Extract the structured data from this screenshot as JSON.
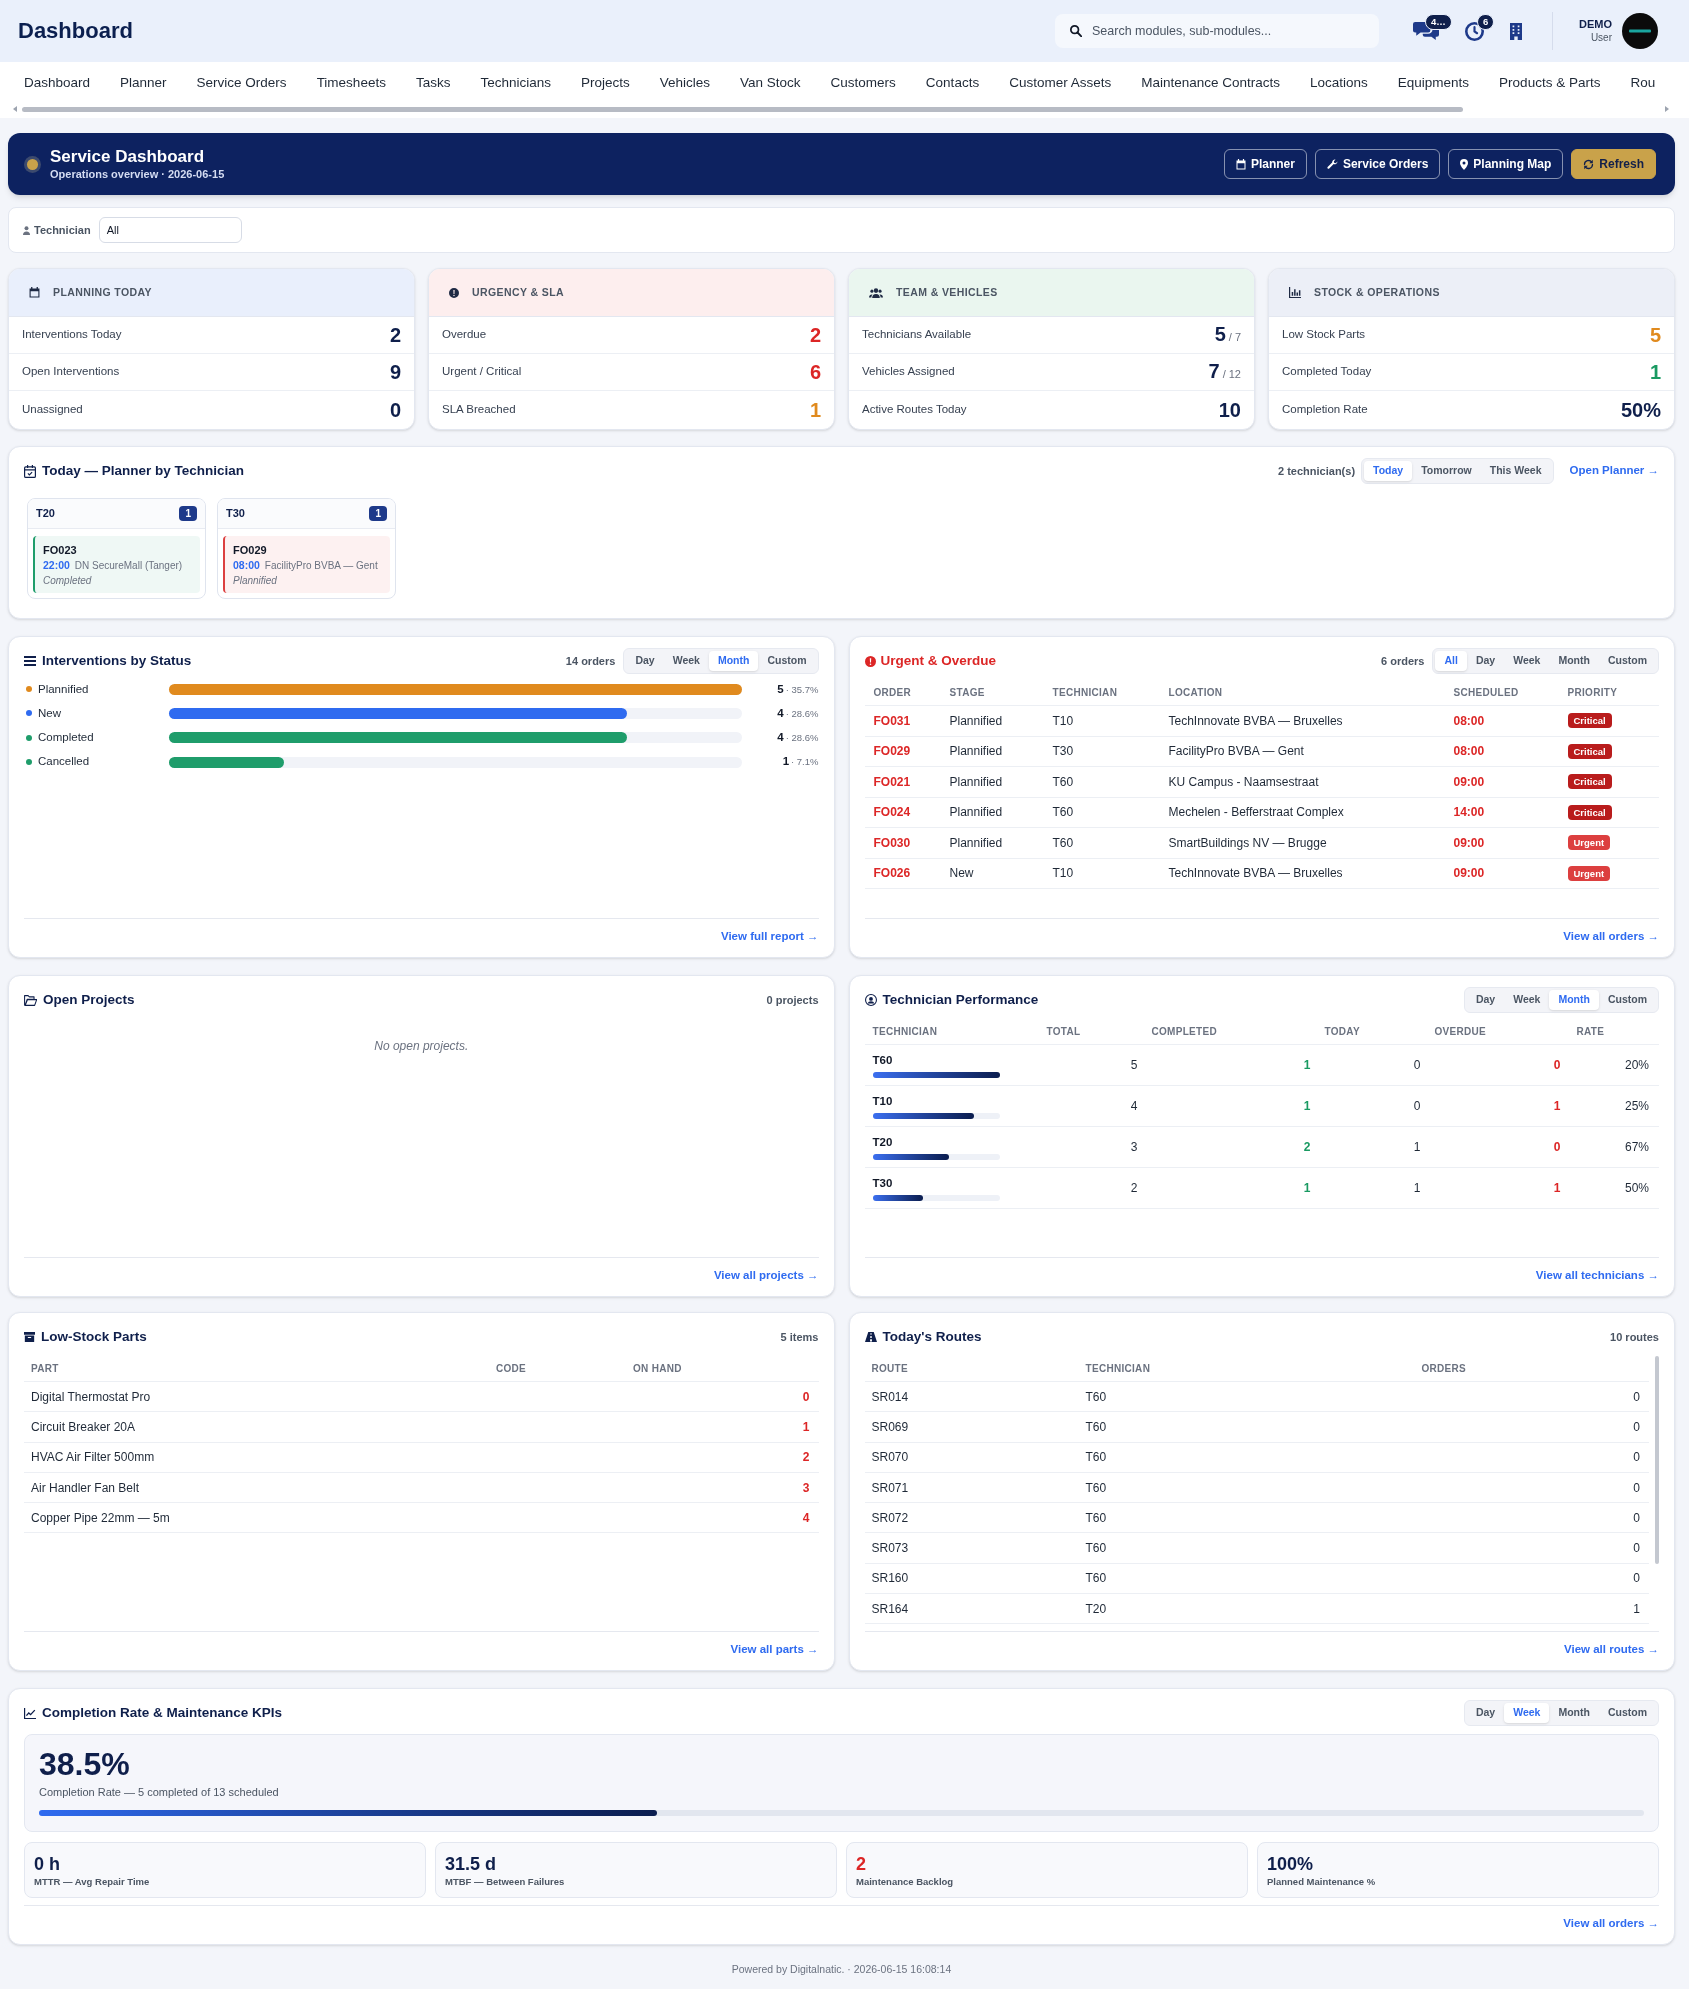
{
  "header": {
    "title": "Dashboard",
    "search": {
      "placeholder": "Search modules, sub-modules..."
    },
    "notifications": [
      {
        "kind": "messages",
        "badge": "4…"
      },
      {
        "kind": "history",
        "badge": "6"
      },
      {
        "kind": "company"
      }
    ],
    "user": {
      "name": "DEMO",
      "role": "User"
    }
  },
  "nav": {
    "items": [
      "Dashboard",
      "Planner",
      "Service Orders",
      "Timesheets",
      "Tasks",
      "Technicians",
      "Projects",
      "Vehicles",
      "Van Stock",
      "Customers",
      "Contacts",
      "Customer Assets",
      "Maintenance Contracts",
      "Locations",
      "Equipments",
      "Products & Parts",
      "Rou"
    ]
  },
  "banner": {
    "title": "Service Dashboard",
    "subtitle": "Operations overview · 2026-06-15",
    "buttons": [
      {
        "label": "Planner",
        "kind": "planner",
        "primary": false
      },
      {
        "label": "Service Orders",
        "kind": "orders",
        "primary": false
      },
      {
        "label": "Planning Map",
        "kind": "map",
        "primary": false
      },
      {
        "label": "Refresh",
        "kind": "refresh",
        "primary": true
      }
    ]
  },
  "filter": {
    "label": "Technician",
    "value": "All"
  },
  "kpi_cards": [
    {
      "title": "PLANNING TODAY",
      "kind": "planning",
      "color": "#e9effc",
      "metrics": [
        {
          "label": "Interventions Today",
          "value": "2",
          "color": "#0f1f4b"
        },
        {
          "label": "Open Interventions",
          "value": "9",
          "color": "#0f1f4b"
        },
        {
          "label": "Unassigned",
          "value": "0",
          "color": "#0f1f4b"
        }
      ]
    },
    {
      "title": "URGENCY & SLA",
      "kind": "urgency",
      "color": "#fdeeee",
      "metrics": [
        {
          "label": "Overdue",
          "value": "2",
          "color": "#dc2626"
        },
        {
          "label": "Urgent / Critical",
          "value": "6",
          "color": "#dc2626"
        },
        {
          "label": "SLA Breached",
          "value": "1",
          "color": "#e08a1e"
        }
      ]
    },
    {
      "title": "TEAM & VEHICLES",
      "kind": "team",
      "color": "#eaf6ef",
      "metrics": [
        {
          "label": "Technicians Available",
          "value": "5",
          "total": "/ 7",
          "color": "#0f1f4b"
        },
        {
          "label": "Vehicles Assigned",
          "value": "7",
          "total": "/ 12",
          "color": "#0f1f4b"
        },
        {
          "label": "Active Routes Today",
          "value": "10",
          "color": "#0f1f4b"
        }
      ]
    },
    {
      "title": "STOCK & OPERATIONS",
      "kind": "stock",
      "color": "#eceff7",
      "metrics": [
        {
          "label": "Low Stock Parts",
          "value": "5",
          "color": "#e08a1e"
        },
        {
          "label": "Completed Today",
          "value": "1",
          "color": "#1a9a62"
        },
        {
          "label": "Completion Rate",
          "value": "50%",
          "color": "#0f1f4b"
        }
      ]
    }
  ],
  "planner": {
    "title": "Today — Planner by Technician",
    "count": "2 technician(s)",
    "tabs": [
      {
        "label": "Today",
        "selected": true
      },
      {
        "label": "Tomorrow",
        "selected": false
      },
      {
        "label": "This Week",
        "selected": false
      }
    ],
    "link": "Open Planner →",
    "technicians": [
      {
        "name": "T20",
        "count": "1",
        "orders": [
          {
            "order": "FO023",
            "time": "22:00",
            "location": "DN SecureMall (Tanger)",
            "status": "Completed",
            "color": "#1f9d6b"
          }
        ]
      },
      {
        "name": "T30",
        "count": "1",
        "orders": [
          {
            "order": "FO029",
            "time": "08:00",
            "location": "FacilityPro BVBA — Gent",
            "status": "Plannified",
            "color": "#dc3f3f"
          }
        ]
      }
    ]
  },
  "status_chart": {
    "title": "Interventions by Status",
    "count": "14 orders",
    "tabs": [
      {
        "label": "Day",
        "selected": false
      },
      {
        "label": "Week",
        "selected": false
      },
      {
        "label": "Month",
        "selected": true
      },
      {
        "label": "Custom",
        "selected": false
      }
    ],
    "rows": [
      {
        "label": "Plannified",
        "color": "#e08a1e",
        "level": 1,
        "value": "5",
        "share": "· 35.7%"
      },
      {
        "label": "New",
        "color": "#2f6bf0",
        "level": 0.8,
        "value": "4",
        "share": "· 28.6%"
      },
      {
        "label": "Completed",
        "color": "#1f9d6b",
        "level": 0.8,
        "value": "4",
        "share": "· 28.6%"
      },
      {
        "label": "Cancelled",
        "color": "#1f9d6b",
        "level": 0.2,
        "value": "1",
        "share": "· 7.1%"
      }
    ],
    "link": "View full report →"
  },
  "urgent": {
    "title": "Urgent & Overdue",
    "count": "6 orders",
    "tabs": [
      {
        "label": "All",
        "selected": true
      },
      {
        "label": "Day",
        "selected": false
      },
      {
        "label": "Week",
        "selected": false
      },
      {
        "label": "Month",
        "selected": false
      },
      {
        "label": "Custom",
        "selected": false
      }
    ],
    "columns": [
      "ORDER",
      "STAGE",
      "TECHNICIAN",
      "LOCATION",
      "SCHEDULED",
      "PRIORITY"
    ],
    "rows": [
      {
        "order": "FO031",
        "stage": "Plannified",
        "technician": "T10",
        "location": "TechInnovate BVBA — Bruxelles",
        "scheduled": "08:00",
        "priority": {
          "label": "Critical",
          "color": "#b91c1c"
        }
      },
      {
        "order": "FO029",
        "stage": "Plannified",
        "technician": "T30",
        "location": "FacilityPro BVBA — Gent",
        "scheduled": "08:00",
        "priority": {
          "label": "Critical",
          "color": "#b91c1c"
        }
      },
      {
        "order": "FO021",
        "stage": "Plannified",
        "technician": "T60",
        "location": "KU Campus - Naamsestraat",
        "scheduled": "09:00",
        "priority": {
          "label": "Critical",
          "color": "#b91c1c"
        }
      },
      {
        "order": "FO024",
        "stage": "Plannified",
        "technician": "T60",
        "location": "Mechelen - Befferstraat Complex",
        "scheduled": "14:00",
        "priority": {
          "label": "Critical",
          "color": "#b91c1c"
        }
      },
      {
        "order": "FO030",
        "stage": "Plannified",
        "technician": "T60",
        "location": "SmartBuildings NV — Brugge",
        "scheduled": "09:00",
        "priority": {
          "label": "Urgent",
          "color": "#dc3f3f"
        }
      },
      {
        "order": "FO026",
        "stage": "New",
        "technician": "T10",
        "location": "TechInnovate BVBA — Bruxelles",
        "scheduled": "09:00",
        "priority": {
          "label": "Urgent",
          "color": "#dc3f3f"
        }
      }
    ],
    "link": "View all orders →"
  },
  "projects": {
    "title": "Open Projects",
    "count": "0 projects",
    "empty": "No open projects.",
    "link": "View all projects →"
  },
  "tech_performance": {
    "title": "Technician Performance",
    "tabs": [
      {
        "label": "Day",
        "selected": false
      },
      {
        "label": "Week",
        "selected": false
      },
      {
        "label": "Month",
        "selected": true
      },
      {
        "label": "Custom",
        "selected": false
      }
    ],
    "columns": [
      "TECHNICIAN",
      "TOTAL",
      "COMPLETED",
      "TODAY",
      "OVERDUE",
      "RATE"
    ],
    "rows": [
      {
        "name": "T60",
        "level": 1,
        "total": "5",
        "completed": "1",
        "today": "0",
        "overdue": "0",
        "rate": "20%"
      },
      {
        "name": "T10",
        "level": 0.8,
        "total": "4",
        "completed": "1",
        "today": "0",
        "overdue": "1",
        "rate": "25%"
      },
      {
        "name": "T20",
        "level": 0.6,
        "total": "3",
        "completed": "2",
        "today": "1",
        "overdue": "0",
        "rate": "67%"
      },
      {
        "name": "T30",
        "level": 0.4,
        "total": "2",
        "completed": "1",
        "today": "1",
        "overdue": "1",
        "rate": "50%"
      }
    ],
    "link": "View all technicians →"
  },
  "low_stock": {
    "title": "Low-Stock Parts",
    "count": "5 items",
    "columns": [
      "PART",
      "CODE",
      "ON HAND"
    ],
    "rows": [
      {
        "part": "Digital Thermostat Pro",
        "on_hand": "0"
      },
      {
        "part": "Circuit Breaker 20A",
        "on_hand": "1"
      },
      {
        "part": "HVAC Air Filter 500mm",
        "on_hand": "2"
      },
      {
        "part": "Air Handler Fan Belt",
        "on_hand": "3"
      },
      {
        "part": "Copper Pipe 22mm — 5m",
        "on_hand": "4"
      }
    ],
    "link": "View all parts →"
  },
  "routes": {
    "title": "Today's Routes",
    "count": "10 routes",
    "columns": [
      "ROUTE",
      "TECHNICIAN",
      "ORDERS"
    ],
    "rows": [
      {
        "route": "SR014",
        "technician": "T60",
        "orders": "0"
      },
      {
        "route": "SR069",
        "technician": "T60",
        "orders": "0"
      },
      {
        "route": "SR070",
        "technician": "T60",
        "orders": "0"
      },
      {
        "route": "SR071",
        "technician": "T60",
        "orders": "0"
      },
      {
        "route": "SR072",
        "technician": "T60",
        "orders": "0"
      },
      {
        "route": "SR073",
        "technician": "T60",
        "orders": "0"
      },
      {
        "route": "SR160",
        "technician": "T60",
        "orders": "0"
      },
      {
        "route": "SR164",
        "technician": "T20",
        "orders": "1"
      }
    ],
    "link": "View all routes →"
  },
  "kpis": {
    "title": "Completion Rate & Maintenance KPIs",
    "tabs": [
      {
        "label": "Day",
        "selected": false
      },
      {
        "label": "Week",
        "selected": true
      },
      {
        "label": "Month",
        "selected": false
      },
      {
        "label": "Custom",
        "selected": false
      }
    ],
    "rate": {
      "value": "38.5%",
      "caption": "Completion Rate — 5 completed of 13 scheduled",
      "level": 0.385
    },
    "tiles": [
      {
        "value": "0 h",
        "label": "MTTR — Avg Repair Time",
        "color": "#0f1f4b"
      },
      {
        "value": "31.5 d",
        "label": "MTBF — Between Failures",
        "color": "#0f1f4b"
      },
      {
        "value": "2",
        "label": "Maintenance Backlog",
        "color": "#dc2626"
      },
      {
        "value": "100%",
        "label": "Planned Maintenance %",
        "color": "#0f1f4b"
      }
    ],
    "link": "View all orders →"
  },
  "footer": "Powered by Digitalnatic. · 2026-06-15 16:08:14"
}
